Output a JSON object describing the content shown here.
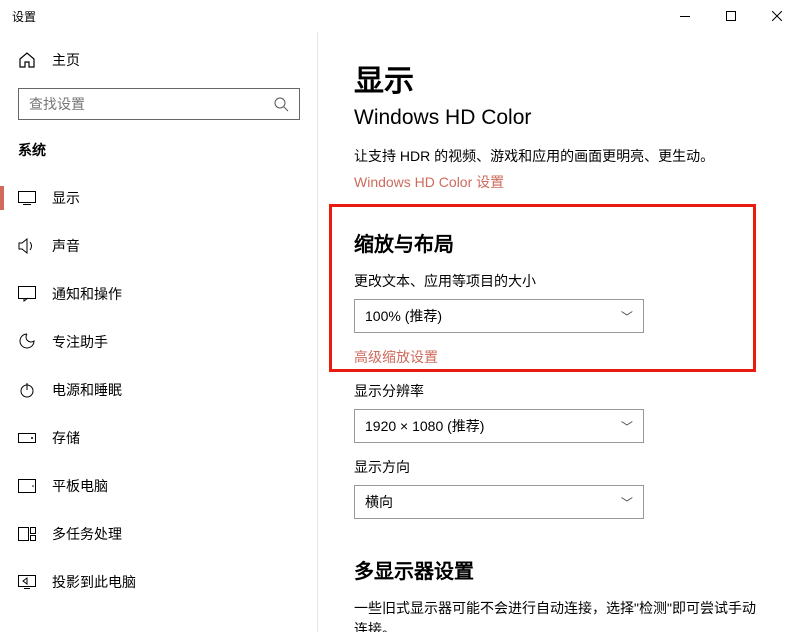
{
  "window": {
    "title": "设置"
  },
  "sidebar": {
    "home": "主页",
    "search_placeholder": "查找设置",
    "category": "系统",
    "items": [
      {
        "label": "显示"
      },
      {
        "label": "声音"
      },
      {
        "label": "通知和操作"
      },
      {
        "label": "专注助手"
      },
      {
        "label": "电源和睡眠"
      },
      {
        "label": "存储"
      },
      {
        "label": "平板电脑"
      },
      {
        "label": "多任务处理"
      },
      {
        "label": "投影到此电脑"
      }
    ]
  },
  "main": {
    "title": "显示",
    "subtitle": "Windows HD Color",
    "hdr_desc": "让支持 HDR 的视频、游戏和应用的画面更明亮、更生动。",
    "hdr_link": "Windows HD Color 设置",
    "scale_section": "缩放与布局",
    "scale_label": "更改文本、应用等项目的大小",
    "scale_value": "100% (推荐)",
    "scale_link": "高级缩放设置",
    "res_label": "显示分辨率",
    "res_value": "1920 × 1080 (推荐)",
    "orient_label": "显示方向",
    "orient_value": "横向",
    "multi_section": "多显示器设置",
    "multi_desc": "一些旧式显示器可能不会进行自动连接，选择\"检测\"即可尝试手动连接。"
  }
}
